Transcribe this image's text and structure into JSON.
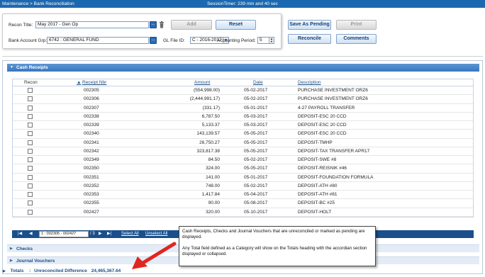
{
  "topbar": {
    "breadcrumb": "Maintenance > Bank Reconciliation",
    "session_timer": "SessionTimer: 239 min and 40 sec"
  },
  "form": {
    "recon_title_label": "Recon Title:",
    "recon_title_value": "May 2017 - Gen Op",
    "bank_account_label": "Bank Account Grp:",
    "bank_account_value": "6742 : GENERAL FUND",
    "gl_file_label": "GL File ID:",
    "gl_file_value": "C - 2016-2017",
    "period_label": "Accounting Period:",
    "period_value": "5",
    "dots": "..."
  },
  "buttons": {
    "add": "Add",
    "reset": "Reset",
    "save_pending": "Save As Pending",
    "print": "Print",
    "reconcile": "Reconcile",
    "comments": "Comments"
  },
  "sections": {
    "cash_receipts": "Cash Receipts",
    "checks": "Checks",
    "journal_vouchers": "Journal Vouchers"
  },
  "grid": {
    "columns": {
      "recon": "Recon",
      "receipt_nbr": "Receipt Nbr",
      "amount": "Amount",
      "date": "Date",
      "description": "Description"
    },
    "rows": [
      {
        "receipt": "002305",
        "amount": "(554,998.00)",
        "date": "05-02-2017",
        "desc": "PURCHASE INVESTMENT ORZ6"
      },
      {
        "receipt": "002306",
        "amount": "(2,444,991.17)",
        "date": "05-02-2017",
        "desc": "PURCHASE INVESTMENT ORZ6"
      },
      {
        "receipt": "002307",
        "amount": "(331.17)",
        "date": "05-01-2017",
        "desc": "4-27 PAYROLL TRANSFER"
      },
      {
        "receipt": "002338",
        "amount": "6,787.50",
        "date": "05-03-2017",
        "desc": "DEPOSIT-ESC 20 CCD"
      },
      {
        "receipt": "002339",
        "amount": "5,133.37",
        "date": "05-03-2017",
        "desc": "DEPOSIT-ESC 20 CCD"
      },
      {
        "receipt": "002340",
        "amount": "143,139.57",
        "date": "05-05-2017",
        "desc": "DEPOSIT-ESC 20 CCD"
      },
      {
        "receipt": "002341",
        "amount": "26,750.27",
        "date": "05-05-2017",
        "desc": "DEPOSIT-TMHP"
      },
      {
        "receipt": "002342",
        "amount": "323,817.38",
        "date": "05-05-2017",
        "desc": "DEPOSIT-TAX TRANSFER APR17"
      },
      {
        "receipt": "002349",
        "amount": "84.50",
        "date": "05-02-2017",
        "desc": "DEPOSIT-SWE #8"
      },
      {
        "receipt": "002350",
        "amount": "324.00",
        "date": "05-05-2017",
        "desc": "DEPOSIT-REISNIK #46"
      },
      {
        "receipt": "002351",
        "amount": "141.00",
        "date": "05-01-2017",
        "desc": "DEPOSIT-FOUNDATION FORMULA"
      },
      {
        "receipt": "002352",
        "amount": "748.00",
        "date": "05-02-2017",
        "desc": "DEPOSIT-ATH #80"
      },
      {
        "receipt": "002353",
        "amount": "1,417.84",
        "date": "05-04-2017",
        "desc": "DEPOSIT-ATH #81"
      },
      {
        "receipt": "002355",
        "amount": "90.00",
        "date": "05-08-2017",
        "desc": "DEPOSIT-BC #25"
      },
      {
        "receipt": "002427",
        "amount": "320.00",
        "date": "05-10-2017",
        "desc": "DEPOSIT-HOLT"
      }
    ]
  },
  "pager": {
    "range": "1 : 002305 - 002427",
    "of_pages": "/ 3",
    "select_all": "Select All",
    "unselect_all": "Unselect All"
  },
  "popup": {
    "line1": "Cash Receipts, Checks and Journal Vouchers that are unreconciled or marked as pending are displayed.",
    "line2": "Any Total field defined as a Category will show on the Totals heading with the accordian section displayed or collapsed."
  },
  "totals": {
    "label": "Totals",
    "separator": ":",
    "diff_label": "Unreconciled Difference",
    "diff_value": "24,465,367.64"
  }
}
